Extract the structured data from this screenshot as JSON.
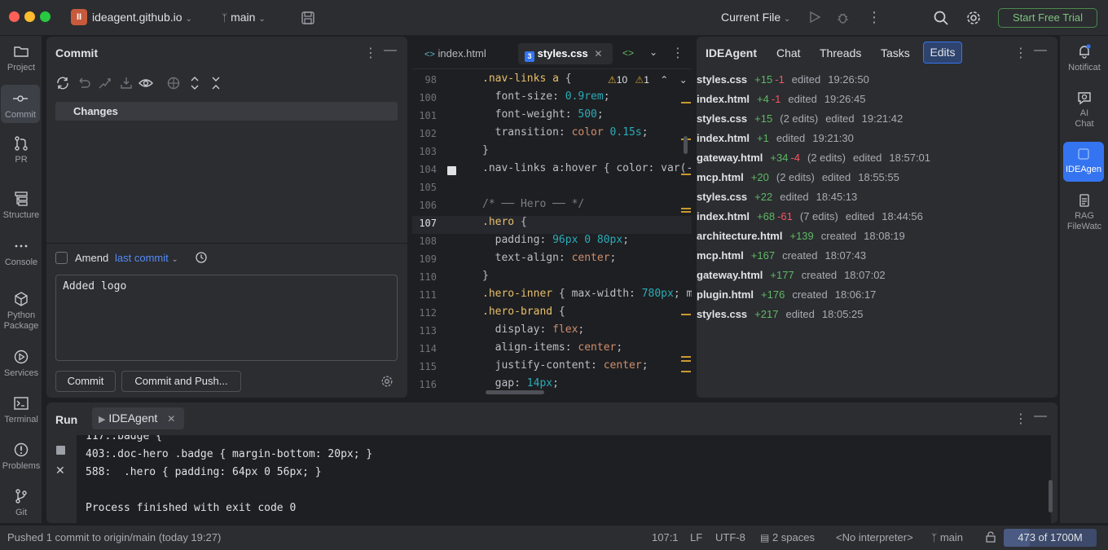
{
  "window": {
    "project_badge": "II",
    "project_name": "ideagent.github.io",
    "branch": "main",
    "run_config": "Current File",
    "trial_button": "Start Free Trial"
  },
  "left_tools": [
    {
      "label": "Project",
      "icon": "folder-icon"
    },
    {
      "label": "Commit",
      "icon": "commit-icon",
      "active": true
    },
    {
      "label": "PR",
      "icon": "pull-request-icon"
    },
    {
      "label": "Structure",
      "icon": "structure-icon"
    },
    {
      "label": "Console",
      "icon": "more-icon"
    },
    {
      "label": "Python Package",
      "icon": "package-icon"
    },
    {
      "label": "Services",
      "icon": "services-icon"
    },
    {
      "label": "Terminal",
      "icon": "terminal-icon"
    },
    {
      "label": "Problems",
      "icon": "problems-icon"
    },
    {
      "label": "Git",
      "icon": "git-icon"
    }
  ],
  "right_tools": [
    {
      "label": "Notificat",
      "icon": "bell-icon"
    },
    {
      "label": "AI Chat",
      "icon": "ai-chat-icon"
    },
    {
      "label": "IDEAgen",
      "icon": "ideagent-icon",
      "active": true
    },
    {
      "label": "RAG FileWatc",
      "icon": "rag-icon"
    }
  ],
  "commit": {
    "title": "Commit",
    "changes_label": "Changes",
    "amend_label": "Amend",
    "amend_link": "last commit",
    "message": "Added logo",
    "commit_button": "Commit",
    "commit_push_button": "Commit and Push..."
  },
  "editor": {
    "tabs": [
      {
        "label": "index.html",
        "active": false
      },
      {
        "label": "styles.css",
        "active": true
      }
    ],
    "warnings": "10",
    "weak_warnings": "1",
    "lines": [
      {
        "n": "98",
        "text": ".nav-links a {"
      },
      {
        "n": "100",
        "text": "  font-size: 0.9rem;"
      },
      {
        "n": "101",
        "text": "  font-weight: 500;"
      },
      {
        "n": "102",
        "text": "  transition: color 0.15s;"
      },
      {
        "n": "103",
        "text": "}"
      },
      {
        "n": "104",
        "text": ".nav-links a:hover { color: var(-"
      },
      {
        "n": "105",
        "text": ""
      },
      {
        "n": "106",
        "text": "/* ── Hero ── */"
      },
      {
        "n": "107",
        "text": ".hero {"
      },
      {
        "n": "108",
        "text": "  padding: 96px 0 80px;"
      },
      {
        "n": "109",
        "text": "  text-align: center;"
      },
      {
        "n": "110",
        "text": "}"
      },
      {
        "n": "111",
        "text": ".hero-inner { max-width: 780px; m"
      },
      {
        "n": "112",
        "text": ".hero-brand {"
      },
      {
        "n": "113",
        "text": "  display: flex;"
      },
      {
        "n": "114",
        "text": "  align-items: center;"
      },
      {
        "n": "115",
        "text": "  justify-content: center;"
      },
      {
        "n": "116",
        "text": "  gap: 14px;"
      }
    ]
  },
  "ideagent": {
    "title": "IDEAgent",
    "tabs": [
      "Chat",
      "Threads",
      "Tasks",
      "Edits"
    ],
    "active_tab": "Edits",
    "edits": [
      {
        "file": "styles.css",
        "add": "+15",
        "del": "-1",
        "count": "",
        "action": "edited",
        "time": "19:26:50"
      },
      {
        "file": "index.html",
        "add": "+4",
        "del": "-1",
        "count": "",
        "action": "edited",
        "time": "19:26:45"
      },
      {
        "file": "styles.css",
        "add": "+15",
        "del": "",
        "count": "(2 edits)",
        "action": "edited",
        "time": "19:21:42"
      },
      {
        "file": "index.html",
        "add": "+1",
        "del": "",
        "count": "",
        "action": "edited",
        "time": "19:21:30"
      },
      {
        "file": "gateway.html",
        "add": "+34",
        "del": "-4",
        "count": "(2 edits)",
        "action": "edited",
        "time": "18:57:01"
      },
      {
        "file": "mcp.html",
        "add": "+20",
        "del": "",
        "count": "(2 edits)",
        "action": "edited",
        "time": "18:55:55"
      },
      {
        "file": "styles.css",
        "add": "+22",
        "del": "",
        "count": "",
        "action": "edited",
        "time": "18:45:13"
      },
      {
        "file": "index.html",
        "add": "+68",
        "del": "-61",
        "count": "(7 edits)",
        "action": "edited",
        "time": "18:44:56"
      },
      {
        "file": "architecture.html",
        "add": "+139",
        "del": "",
        "count": "",
        "action": "created",
        "time": "18:08:19"
      },
      {
        "file": "mcp.html",
        "add": "+167",
        "del": "",
        "count": "",
        "action": "created",
        "time": "18:07:43"
      },
      {
        "file": "gateway.html",
        "add": "+177",
        "del": "",
        "count": "",
        "action": "created",
        "time": "18:07:02"
      },
      {
        "file": "plugin.html",
        "add": "+176",
        "del": "",
        "count": "",
        "action": "created",
        "time": "18:06:17"
      },
      {
        "file": "styles.css",
        "add": "+217",
        "del": "",
        "count": "",
        "action": "edited",
        "time": "18:05:25"
      }
    ]
  },
  "run": {
    "title": "Run",
    "tab": "IDEAgent",
    "lines": [
      "117:.badge {",
      "403:.doc-hero .badge { margin-bottom: 20px; }",
      "588:  .hero { padding: 64px 0 56px; }",
      "",
      "Process finished with exit code 0"
    ]
  },
  "status": {
    "message": "Pushed 1 commit to origin/main (today 19:27)",
    "position": "107:1",
    "line_sep": "LF",
    "encoding": "UTF-8",
    "indent": "2 spaces",
    "interpreter": "<No interpreter>",
    "branch": "main",
    "memory": "473 of 1700M",
    "memory_fraction": 0.28
  }
}
